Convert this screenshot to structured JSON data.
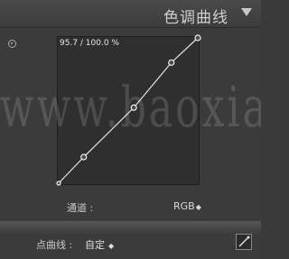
{
  "header": {
    "title": "色调曲线",
    "collapse_icon": "triangle-down-icon"
  },
  "curve": {
    "readout": "95.7 / 100.0 %",
    "control_points_percent": [
      [
        0,
        0
      ],
      [
        18,
        18
      ],
      [
        54,
        52
      ],
      [
        81,
        83
      ],
      [
        100,
        100
      ]
    ]
  },
  "channel": {
    "label": "通道 :",
    "value": "RGB",
    "arrows": "◆"
  },
  "point_curve": {
    "label": "点曲线 :",
    "value": "自定",
    "arrows": "◆"
  },
  "watermark": "www.baoxiaoshei.com",
  "icons": {
    "target": "target-adjust-icon",
    "curve_tool": "curve-edit-icon"
  }
}
